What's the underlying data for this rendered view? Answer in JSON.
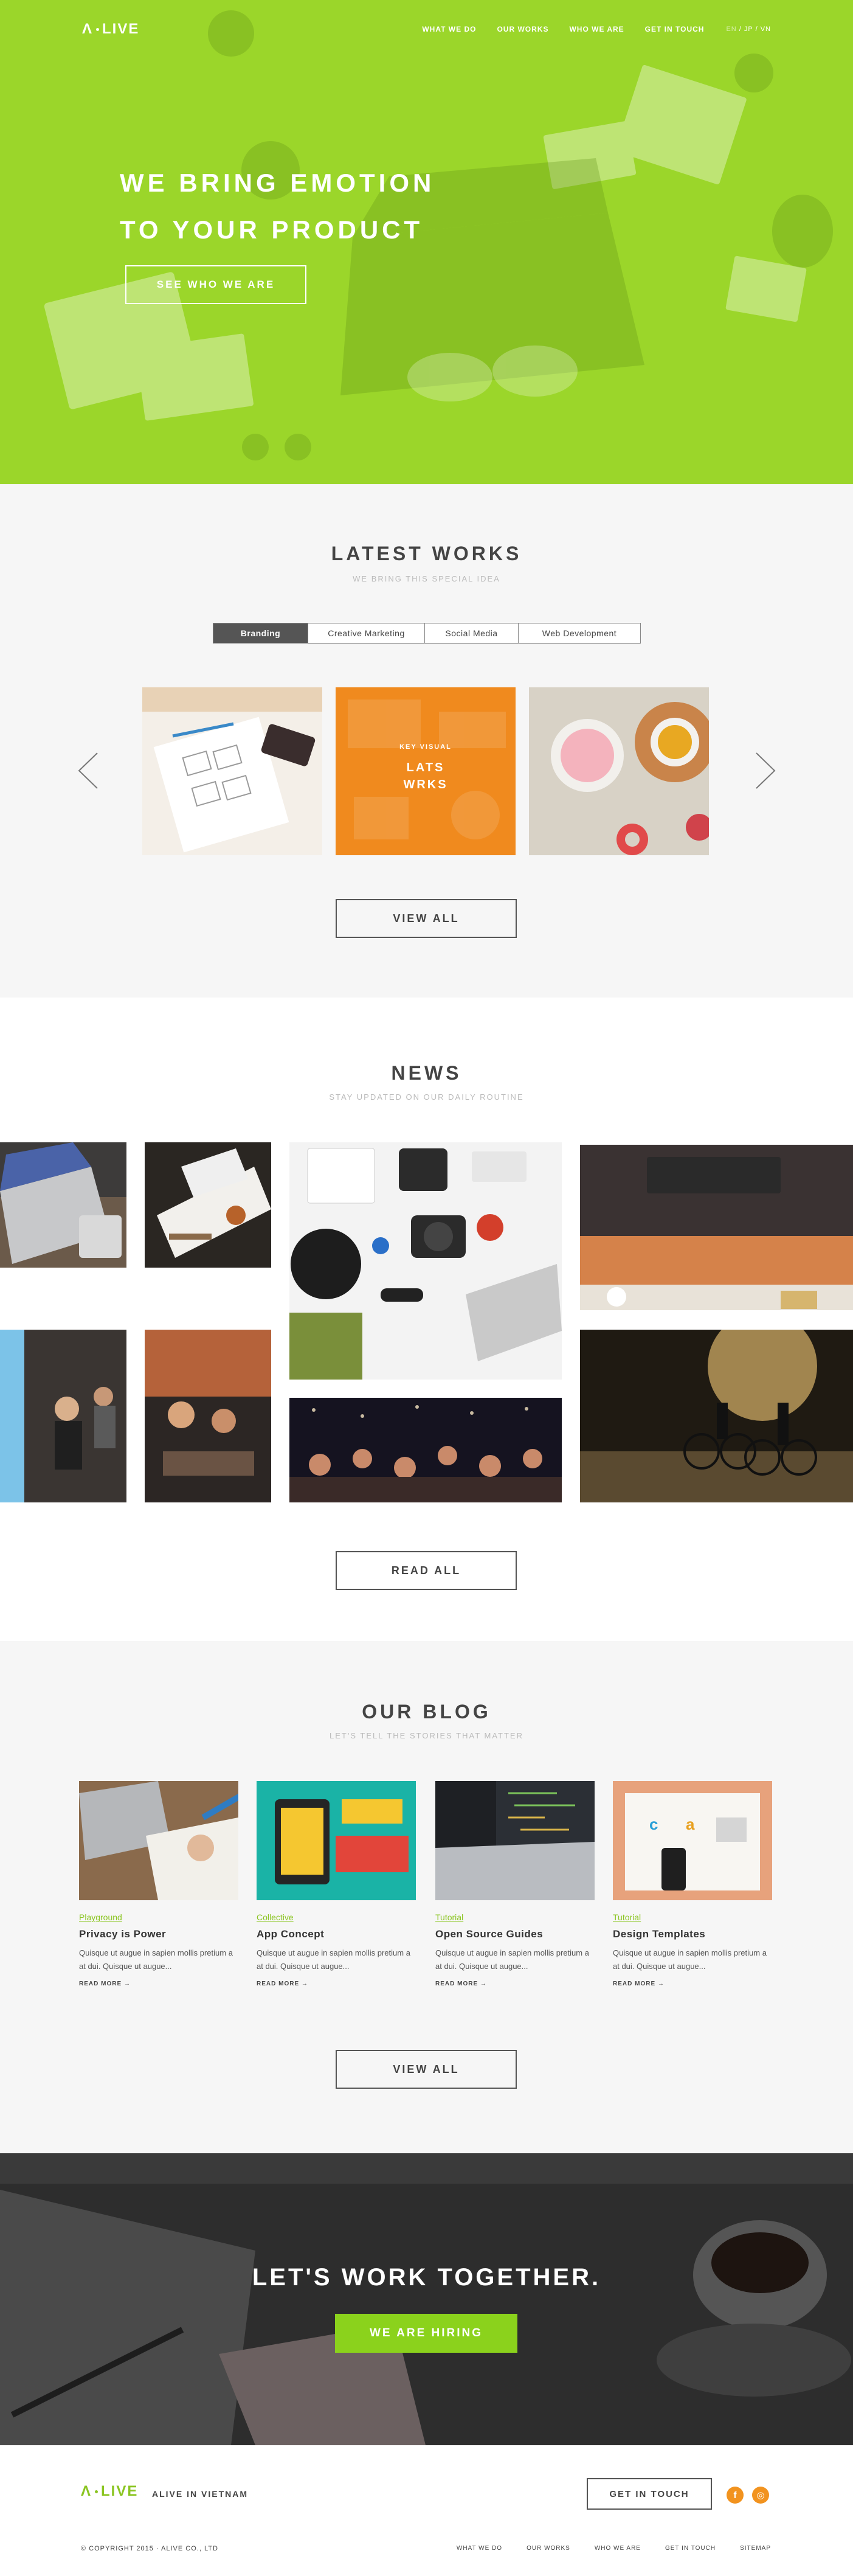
{
  "header": {
    "logo_left": "Λ",
    "logo_right": "LIVE",
    "nav": [
      "WHAT WE DO",
      "OUR WORKS",
      "WHO WE ARE",
      "GET IN TOUCH"
    ],
    "lang_active": "EN",
    "lang_rest": " / JP / VN"
  },
  "hero": {
    "title_line1": "WE BRING EMOTION",
    "title_line2": "TO YOUR PRODUCT",
    "button": "SEE WHO WE ARE",
    "overlay_color": "#9BD62A"
  },
  "works": {
    "title": "LATEST WORKS",
    "subtitle": "WE BRING THIS SPECIAL IDEA",
    "tabs": [
      "Branding",
      "Creative Marketing",
      "Social Media",
      "Web Development"
    ],
    "active_tab": "Branding",
    "featured_small": "KEY VISUAL",
    "featured_big_1": "LATS",
    "featured_big_2": "WRKS",
    "view_all": "VIEW ALL",
    "accent": "#F08A1E"
  },
  "news": {
    "title": "NEWS",
    "subtitle": "STAY UPDATED ON OUR DAILY ROUTINE",
    "read_all": "READ ALL"
  },
  "blog": {
    "title": "OUR BLOG",
    "subtitle": "LET'S TELL THE STORIES THAT MATTER",
    "posts": [
      {
        "category": "Playground",
        "title": "Privacy is Power",
        "text": "Quisque ut augue in sapien mollis pretium a at dui. Quisque ut augue...",
        "more": "READ MORE →"
      },
      {
        "category": "Collective",
        "title": "App Concept",
        "text": "Quisque ut augue in sapien mollis pretium a at dui. Quisque ut augue...",
        "more": "READ MORE →"
      },
      {
        "category": "Tutorial",
        "title": "Open Source Guides",
        "text": "Quisque ut augue in sapien mollis pretium a at dui. Quisque ut augue...",
        "more": "READ MORE →"
      },
      {
        "category": "Tutorial",
        "title": "Design Templates",
        "text": "Quisque ut augue in sapien mollis pretium a at dui. Quisque ut augue...",
        "more": "READ MORE →"
      }
    ],
    "view_all": "VIEW ALL",
    "accent": "#8BC522"
  },
  "cta": {
    "title": "LET'S WORK TOGETHER.",
    "button": "WE ARE HIRING",
    "button_color": "#8BD21C"
  },
  "footer": {
    "logo_left": "Λ",
    "logo_right": "LIVE",
    "tagline": "ALIVE IN VIETNAM",
    "button": "GET IN TOUCH",
    "social": [
      "f",
      "◎"
    ],
    "copyright": "© COPYRIGHT 2015 · ALIVE CO., LTD",
    "nav": [
      "WHAT WE DO",
      "OUR WORKS",
      "WHO WE ARE",
      "GET IN TOUCH",
      "SITEMAP"
    ]
  }
}
